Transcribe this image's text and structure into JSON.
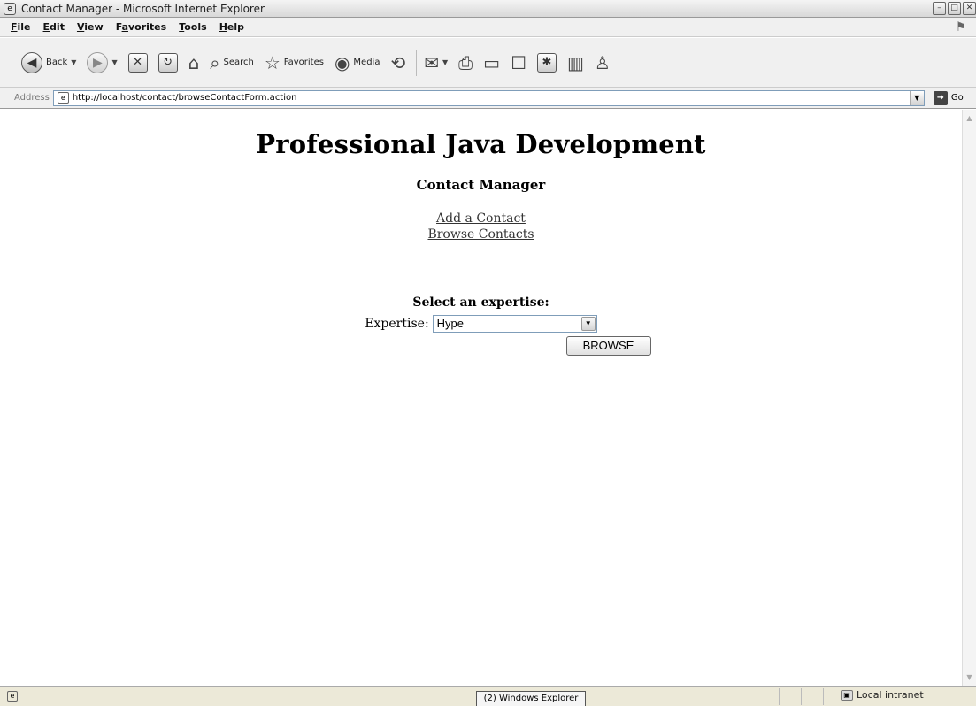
{
  "window": {
    "title": "Contact Manager - Microsoft Internet Explorer",
    "controls": [
      "minimize",
      "maximize",
      "close"
    ]
  },
  "menubar": {
    "items": [
      {
        "label": "File",
        "accel": "F"
      },
      {
        "label": "Edit",
        "accel": "E"
      },
      {
        "label": "View",
        "accel": "V"
      },
      {
        "label": "Favorites",
        "accel": "a"
      },
      {
        "label": "Tools",
        "accel": "T"
      },
      {
        "label": "Help",
        "accel": "H"
      }
    ]
  },
  "toolbar": {
    "back_label": "Back",
    "search_label": "Search",
    "favorites_label": "Favorites",
    "media_label": "Media"
  },
  "address": {
    "label": "Address",
    "url": "http://localhost/contact/browseContactForm.action",
    "go_label": "Go"
  },
  "page": {
    "title": "Professional Java Development",
    "app_title": "Contact Manager",
    "links": [
      "Add a Contact",
      "Browse Contacts"
    ],
    "select_heading": "Select an expertise:",
    "expertise_label": "Expertise:",
    "expertise_value": "Hype",
    "browse_button": "BROWSE"
  },
  "statusbar": {
    "taskbar_item": "(2) Windows Explorer",
    "zone": "Local intranet"
  }
}
